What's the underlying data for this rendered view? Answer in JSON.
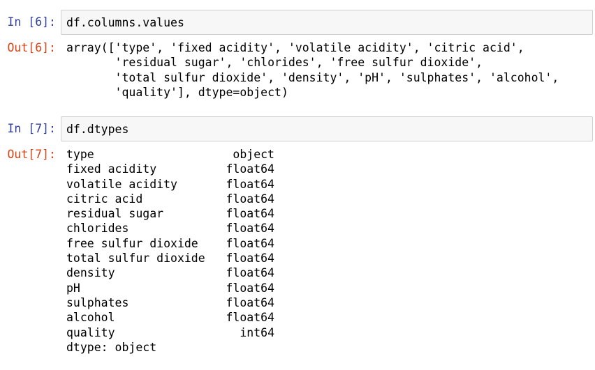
{
  "cells": [
    {
      "in_prompt": "In [6]:",
      "code": "df.columns.values",
      "out_prompt": "Out[6]:",
      "output_lines": [
        "array(['type', 'fixed acidity', 'volatile acidity', 'citric acid',",
        "       'residual sugar', 'chlorides', 'free sulfur dioxide',",
        "       'total sulfur dioxide', 'density', 'pH', 'sulphates', 'alcohol',",
        "       'quality'], dtype=object)"
      ]
    },
    {
      "in_prompt": "In [7]:",
      "code": "df.dtypes",
      "out_prompt": "Out[7]:",
      "dtypes": [
        {
          "name": "type",
          "dtype": "object"
        },
        {
          "name": "fixed acidity",
          "dtype": "float64"
        },
        {
          "name": "volatile acidity",
          "dtype": "float64"
        },
        {
          "name": "citric acid",
          "dtype": "float64"
        },
        {
          "name": "residual sugar",
          "dtype": "float64"
        },
        {
          "name": "chlorides",
          "dtype": "float64"
        },
        {
          "name": "free sulfur dioxide",
          "dtype": "float64"
        },
        {
          "name": "total sulfur dioxide",
          "dtype": "float64"
        },
        {
          "name": "density",
          "dtype": "float64"
        },
        {
          "name": "pH",
          "dtype": "float64"
        },
        {
          "name": "sulphates",
          "dtype": "float64"
        },
        {
          "name": "alcohol",
          "dtype": "float64"
        },
        {
          "name": "quality",
          "dtype": "int64"
        }
      ],
      "footer": "dtype: object"
    }
  ],
  "colors": {
    "in_prompt": "#303f9f",
    "out_prompt": "#d84315",
    "input_bg": "#f7f7f7",
    "input_border": "#cfcfcf"
  }
}
